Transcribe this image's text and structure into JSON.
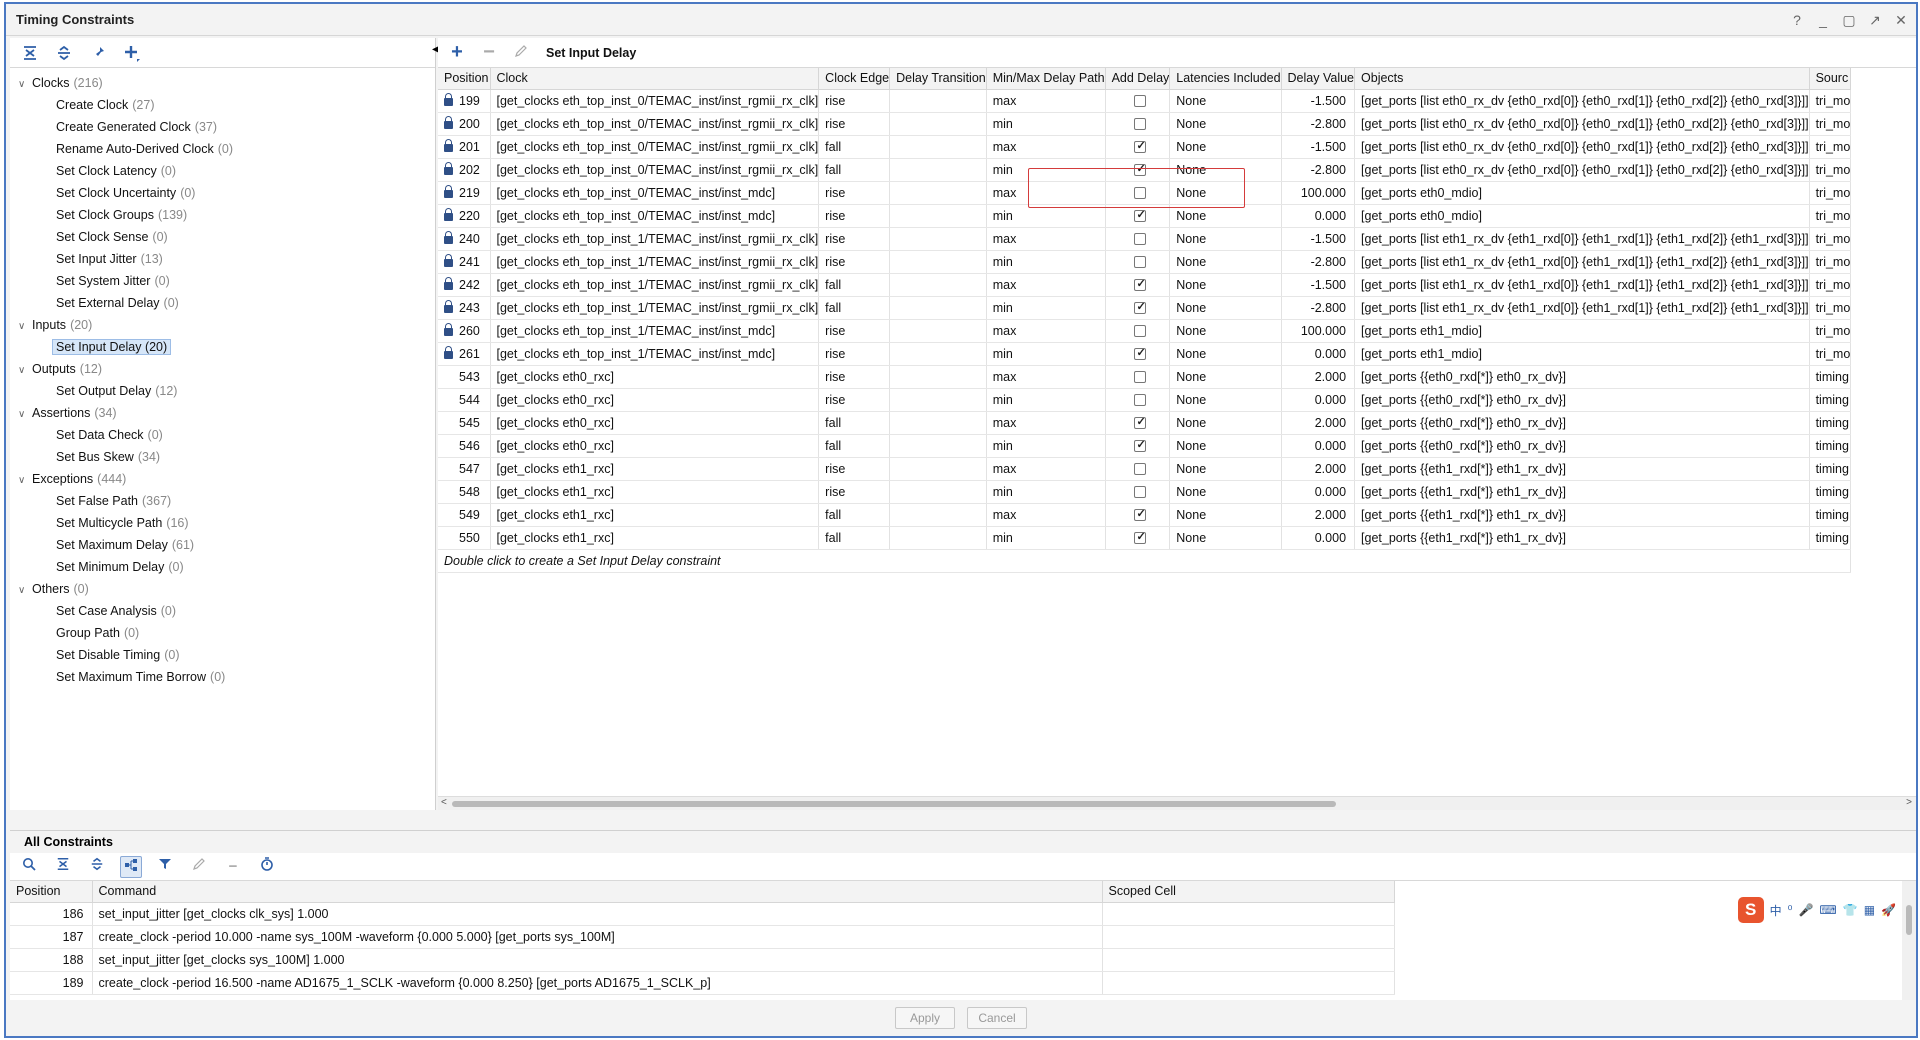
{
  "window": {
    "title": "Timing Constraints",
    "controls": [
      "?",
      "_",
      "▢",
      "↗",
      "✕"
    ]
  },
  "tree": [
    {
      "type": "cat",
      "label": "Clocks",
      "count": "(216)",
      "expanded": true
    },
    {
      "type": "item",
      "label": "Create Clock",
      "count": "(27)"
    },
    {
      "type": "item",
      "label": "Create Generated Clock",
      "count": "(37)"
    },
    {
      "type": "item",
      "label": "Rename Auto-Derived Clock",
      "count": "(0)"
    },
    {
      "type": "item",
      "label": "Set Clock Latency",
      "count": "(0)"
    },
    {
      "type": "item",
      "label": "Set Clock Uncertainty",
      "count": "(0)"
    },
    {
      "type": "item",
      "label": "Set Clock Groups",
      "count": "(139)"
    },
    {
      "type": "item",
      "label": "Set Clock Sense",
      "count": "(0)"
    },
    {
      "type": "item",
      "label": "Set Input Jitter",
      "count": "(13)"
    },
    {
      "type": "item",
      "label": "Set System Jitter",
      "count": "(0)"
    },
    {
      "type": "item",
      "label": "Set External Delay",
      "count": "(0)"
    },
    {
      "type": "cat",
      "label": "Inputs",
      "count": "(20)",
      "expanded": true
    },
    {
      "type": "item",
      "label": "Set Input Delay (20)",
      "count": "",
      "selected": true
    },
    {
      "type": "cat",
      "label": "Outputs",
      "count": "(12)",
      "expanded": true
    },
    {
      "type": "item",
      "label": "Set Output Delay",
      "count": "(12)"
    },
    {
      "type": "cat",
      "label": "Assertions",
      "count": "(34)",
      "expanded": true
    },
    {
      "type": "item",
      "label": "Set Data Check",
      "count": "(0)"
    },
    {
      "type": "item",
      "label": "Set Bus Skew",
      "count": "(34)"
    },
    {
      "type": "cat",
      "label": "Exceptions",
      "count": "(444)",
      "expanded": true
    },
    {
      "type": "item",
      "label": "Set False Path",
      "count": "(367)"
    },
    {
      "type": "item",
      "label": "Set Multicycle Path",
      "count": "(16)"
    },
    {
      "type": "item",
      "label": "Set Maximum Delay",
      "count": "(61)"
    },
    {
      "type": "item",
      "label": "Set Minimum Delay",
      "count": "(0)"
    },
    {
      "type": "cat",
      "label": "Others",
      "count": "(0)",
      "expanded": true
    },
    {
      "type": "item",
      "label": "Set Case Analysis",
      "count": "(0)"
    },
    {
      "type": "item",
      "label": "Group Path",
      "count": "(0)"
    },
    {
      "type": "item",
      "label": "Set Disable Timing",
      "count": "(0)"
    },
    {
      "type": "item",
      "label": "Set Maximum Time Borrow",
      "count": "(0)"
    }
  ],
  "right": {
    "title": "Set Input Delay",
    "columns": [
      "Position",
      "Clock",
      "Clock Edge",
      "Delay Transition",
      "Min/Max Delay Path",
      "Add Delay",
      "Latencies Included",
      "Delay Value",
      "Objects",
      "Sourc"
    ],
    "rows": [
      {
        "locked": true,
        "pos": "199",
        "clock": "[get_clocks eth_top_inst_0/TEMAC_inst/inst_rgmii_rx_clk]",
        "edge": "rise",
        "trans": "",
        "minmax": "max",
        "add": false,
        "lat": "None",
        "val": "-1.500",
        "obj": "[get_ports [list eth0_rx_dv {eth0_rxd[0]} {eth0_rxd[1]} {eth0_rxd[2]} {eth0_rxd[3]}]]",
        "src": "tri_mo"
      },
      {
        "locked": true,
        "pos": "200",
        "clock": "[get_clocks eth_top_inst_0/TEMAC_inst/inst_rgmii_rx_clk]",
        "edge": "rise",
        "trans": "",
        "minmax": "min",
        "add": false,
        "lat": "None",
        "val": "-2.800",
        "obj": "[get_ports [list eth0_rx_dv {eth0_rxd[0]} {eth0_rxd[1]} {eth0_rxd[2]} {eth0_rxd[3]}]]",
        "src": "tri_mo"
      },
      {
        "locked": true,
        "pos": "201",
        "clock": "[get_clocks eth_top_inst_0/TEMAC_inst/inst_rgmii_rx_clk]",
        "edge": "fall",
        "trans": "",
        "minmax": "max",
        "add": true,
        "lat": "None",
        "val": "-1.500",
        "obj": "[get_ports [list eth0_rx_dv {eth0_rxd[0]} {eth0_rxd[1]} {eth0_rxd[2]} {eth0_rxd[3]}]]",
        "src": "tri_mo"
      },
      {
        "locked": true,
        "pos": "202",
        "clock": "[get_clocks eth_top_inst_0/TEMAC_inst/inst_rgmii_rx_clk]",
        "edge": "fall",
        "trans": "",
        "minmax": "min",
        "add": true,
        "lat": "None",
        "val": "-2.800",
        "obj": "[get_ports [list eth0_rx_dv {eth0_rxd[0]} {eth0_rxd[1]} {eth0_rxd[2]} {eth0_rxd[3]}]]",
        "src": "tri_mo"
      },
      {
        "locked": true,
        "pos": "219",
        "clock": "[get_clocks eth_top_inst_0/TEMAC_inst/inst_mdc]",
        "edge": "rise",
        "trans": "",
        "minmax": "max",
        "add": false,
        "lat": "None",
        "val": "100.000",
        "obj": "[get_ports eth0_mdio]",
        "src": "tri_mo"
      },
      {
        "locked": true,
        "pos": "220",
        "clock": "[get_clocks eth_top_inst_0/TEMAC_inst/inst_mdc]",
        "edge": "rise",
        "trans": "",
        "minmax": "min",
        "add": true,
        "lat": "None",
        "val": "0.000",
        "obj": "[get_ports eth0_mdio]",
        "src": "tri_mo"
      },
      {
        "locked": true,
        "pos": "240",
        "clock": "[get_clocks eth_top_inst_1/TEMAC_inst/inst_rgmii_rx_clk]",
        "edge": "rise",
        "trans": "",
        "minmax": "max",
        "add": false,
        "lat": "None",
        "val": "-1.500",
        "obj": "[get_ports [list eth1_rx_dv {eth1_rxd[0]} {eth1_rxd[1]} {eth1_rxd[2]} {eth1_rxd[3]}]]",
        "src": "tri_mo"
      },
      {
        "locked": true,
        "pos": "241",
        "clock": "[get_clocks eth_top_inst_1/TEMAC_inst/inst_rgmii_rx_clk]",
        "edge": "rise",
        "trans": "",
        "minmax": "min",
        "add": false,
        "lat": "None",
        "val": "-2.800",
        "obj": "[get_ports [list eth1_rx_dv {eth1_rxd[0]} {eth1_rxd[1]} {eth1_rxd[2]} {eth1_rxd[3]}]]",
        "src": "tri_mo"
      },
      {
        "locked": true,
        "pos": "242",
        "clock": "[get_clocks eth_top_inst_1/TEMAC_inst/inst_rgmii_rx_clk]",
        "edge": "fall",
        "trans": "",
        "minmax": "max",
        "add": true,
        "lat": "None",
        "val": "-1.500",
        "obj": "[get_ports [list eth1_rx_dv {eth1_rxd[0]} {eth1_rxd[1]} {eth1_rxd[2]} {eth1_rxd[3]}]]",
        "src": "tri_mo"
      },
      {
        "locked": true,
        "pos": "243",
        "clock": "[get_clocks eth_top_inst_1/TEMAC_inst/inst_rgmii_rx_clk]",
        "edge": "fall",
        "trans": "",
        "minmax": "min",
        "add": true,
        "lat": "None",
        "val": "-2.800",
        "obj": "[get_ports [list eth1_rx_dv {eth1_rxd[0]} {eth1_rxd[1]} {eth1_rxd[2]} {eth1_rxd[3]}]]",
        "src": "tri_mo"
      },
      {
        "locked": true,
        "pos": "260",
        "clock": "[get_clocks eth_top_inst_1/TEMAC_inst/inst_mdc]",
        "edge": "rise",
        "trans": "",
        "minmax": "max",
        "add": false,
        "lat": "None",
        "val": "100.000",
        "obj": "[get_ports eth1_mdio]",
        "src": "tri_mo"
      },
      {
        "locked": true,
        "pos": "261",
        "clock": "[get_clocks eth_top_inst_1/TEMAC_inst/inst_mdc]",
        "edge": "rise",
        "trans": "",
        "minmax": "min",
        "add": true,
        "lat": "None",
        "val": "0.000",
        "obj": "[get_ports eth1_mdio]",
        "src": "tri_mo"
      },
      {
        "locked": false,
        "pos": "543",
        "clock": "[get_clocks eth0_rxc]",
        "edge": "rise",
        "trans": "",
        "minmax": "max",
        "add": false,
        "lat": "None",
        "val": "2.000",
        "obj": "[get_ports {{eth0_rxd[*]} eth0_rx_dv}]",
        "src": "timing"
      },
      {
        "locked": false,
        "pos": "544",
        "clock": "[get_clocks eth0_rxc]",
        "edge": "rise",
        "trans": "",
        "minmax": "min",
        "add": false,
        "lat": "None",
        "val": "0.000",
        "obj": "[get_ports {{eth0_rxd[*]} eth0_rx_dv}]",
        "src": "timing"
      },
      {
        "locked": false,
        "pos": "545",
        "clock": "[get_clocks eth0_rxc]",
        "edge": "fall",
        "trans": "",
        "minmax": "max",
        "add": true,
        "lat": "None",
        "val": "2.000",
        "obj": "[get_ports {{eth0_rxd[*]} eth0_rx_dv}]",
        "src": "timing"
      },
      {
        "locked": false,
        "pos": "546",
        "clock": "[get_clocks eth0_rxc]",
        "edge": "fall",
        "trans": "",
        "minmax": "min",
        "add": true,
        "lat": "None",
        "val": "0.000",
        "obj": "[get_ports {{eth0_rxd[*]} eth0_rx_dv}]",
        "src": "timing"
      },
      {
        "locked": false,
        "pos": "547",
        "clock": "[get_clocks eth1_rxc]",
        "edge": "rise",
        "trans": "",
        "minmax": "max",
        "add": false,
        "lat": "None",
        "val": "2.000",
        "obj": "[get_ports {{eth1_rxd[*]} eth1_rx_dv}]",
        "src": "timing"
      },
      {
        "locked": false,
        "pos": "548",
        "clock": "[get_clocks eth1_rxc]",
        "edge": "rise",
        "trans": "",
        "minmax": "min",
        "add": false,
        "lat": "None",
        "val": "0.000",
        "obj": "[get_ports {{eth1_rxd[*]} eth1_rx_dv}]",
        "src": "timing"
      },
      {
        "locked": false,
        "pos": "549",
        "clock": "[get_clocks eth1_rxc]",
        "edge": "fall",
        "trans": "",
        "minmax": "max",
        "add": true,
        "lat": "None",
        "val": "2.000",
        "obj": "[get_ports {{eth1_rxd[*]} eth1_rx_dv}]",
        "src": "timing"
      },
      {
        "locked": false,
        "pos": "550",
        "clock": "[get_clocks eth1_rxc]",
        "edge": "fall",
        "trans": "",
        "minmax": "min",
        "add": true,
        "lat": "None",
        "val": "0.000",
        "obj": "[get_ports {{eth1_rxd[*]} eth1_rx_dv}]",
        "src": "timing"
      }
    ],
    "hint": "Double click to create a Set Input Delay constraint"
  },
  "bottom": {
    "title": "All Constraints",
    "columns": [
      "Position",
      "Command",
      "Scoped Cell"
    ],
    "rows": [
      {
        "pos": "186",
        "cmd": "set_input_jitter [get_clocks clk_sys] 1.000",
        "cell": ""
      },
      {
        "pos": "187",
        "cmd": "create_clock -period 10.000 -name sys_100M -waveform {0.000 5.000} [get_ports sys_100M]",
        "cell": ""
      },
      {
        "pos": "188",
        "cmd": "set_input_jitter [get_clocks sys_100M] 1.000",
        "cell": ""
      },
      {
        "pos": "189",
        "cmd": "create_clock -period 16.500 -name AD1675_1_SCLK -waveform {0.000 8.250} [get_ports AD1675_1_SCLK_p]",
        "cell": ""
      }
    ],
    "ime": [
      "中",
      "⁰",
      "🎤",
      "⌨",
      "👕",
      "▦",
      "🚀"
    ]
  },
  "footer": {
    "apply": "Apply",
    "cancel": "Cancel"
  },
  "colors": {
    "accent": "#2e5fa8",
    "highlight_box": "#d43b3b",
    "window_border": "#4a78c2"
  }
}
